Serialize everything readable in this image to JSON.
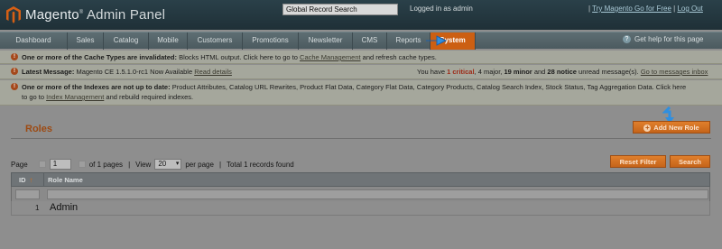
{
  "header": {
    "brand_name": "Magento",
    "brand_suffix": "Admin Panel",
    "search_value": "Global Record Search",
    "logged_in": "Logged in as admin",
    "separator": "|",
    "try_link": "Try Magento Go for Free",
    "logout": "Log Out"
  },
  "nav": {
    "items": [
      {
        "label": "Dashboard"
      },
      {
        "label": "Sales"
      },
      {
        "label": "Catalog"
      },
      {
        "label": "Mobile"
      },
      {
        "label": "Customers"
      },
      {
        "label": "Promotions"
      },
      {
        "label": "Newsletter"
      },
      {
        "label": "CMS"
      },
      {
        "label": "Reports"
      },
      {
        "label": "System"
      }
    ],
    "active": "System",
    "help": "Get help for this page"
  },
  "messages": {
    "cache": {
      "bold": "One or more of the Cache Types are invalidated:",
      "text1": " Blocks HTML output. Click here to go to ",
      "link": "Cache Management",
      "text2": " and refresh cache types."
    },
    "latest": {
      "bold": "Latest Message:",
      "text": " Magento CE 1.5.1.0-rc1 Now Available ",
      "link": "Read details",
      "right_prefix": "You have ",
      "critical": "1 critical",
      "major": ", 4 major, ",
      "minor": "19 minor",
      "and": " and ",
      "notice": "28 notice",
      "suffix": " unread message(s). ",
      "inbox_link": "Go to messages inbox"
    },
    "index": {
      "bold": "One or more of the Indexes are not up to date:",
      "text1": " Product Attributes, Catalog URL Rewrites, Product Flat Data, Category Flat Data, Category Products, Catalog Search Index, Stock Status, Tag Aggregation Data. Click here",
      "text2": "to go to ",
      "link": "Index Management",
      "text3": " and rebuild required indexes."
    }
  },
  "page": {
    "title": "Roles",
    "add_button": "Add New Role"
  },
  "pager": {
    "page_label": "Page",
    "page_value": "1",
    "of_pages": "of 1 pages",
    "view_label": "View",
    "view_value": "20",
    "per_page": "per page",
    "records": "Total 1 records found",
    "reset_filter": "Reset Filter",
    "search": "Search"
  },
  "table": {
    "columns": [
      "ID",
      "Role Name"
    ],
    "rows": [
      {
        "id": "1",
        "name": "Admin"
      }
    ]
  },
  "colors": {
    "accent": "#cc5f12",
    "header_bg": "#2a4049",
    "critical": "#9d2b18"
  }
}
